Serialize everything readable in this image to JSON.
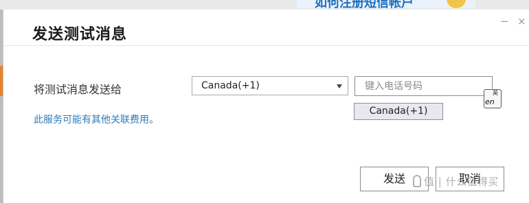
{
  "background": {
    "ad_text": "如何注册短信帐户"
  },
  "dialog": {
    "title": "发送测试消息",
    "window_controls": {
      "minimize": "−",
      "close": "×"
    },
    "field_label": "将测试消息发送给",
    "country_select": {
      "value": "Canada(+1)"
    },
    "phone_input": {
      "value": "",
      "placeholder": "键入电话号码"
    },
    "ime_indicator": {
      "top": "英",
      "main": "en"
    },
    "suggestion": "Canada(+1)",
    "note": "此服务可能有其他关联费用。",
    "buttons": {
      "send": "发送",
      "cancel": "取消"
    }
  },
  "watermark": "值 | 什么值得买",
  "colors": {
    "link": "#2e7bb8",
    "accent_orange": "#e8832a",
    "ad_blue": "#1e6fbf"
  }
}
